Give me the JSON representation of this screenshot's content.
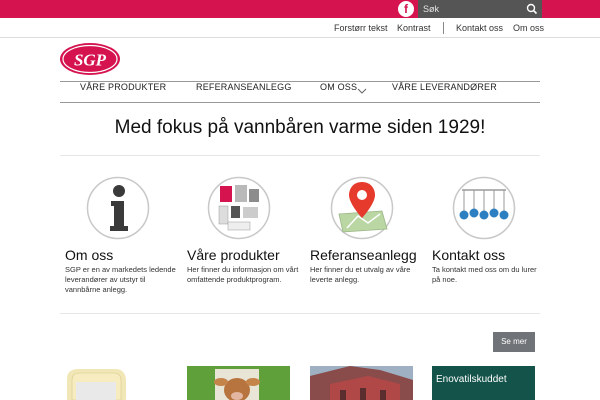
{
  "topbar": {
    "facebook_glyph": "f",
    "search": {
      "placeholder": "Søk"
    }
  },
  "utility_nav": {
    "text_size_label": "Forstørr tekst",
    "contrast_label": "Kontrast",
    "contact_label": "Kontakt oss",
    "about_label": "Om oss"
  },
  "logo": {
    "text": "SGP"
  },
  "main_nav": {
    "items": [
      {
        "label": "VÅRE PRODUKTER"
      },
      {
        "label": "REFERANSEANLEGG"
      },
      {
        "label": "OM OSS"
      },
      {
        "label": "VÅRE LEVERANDØRER"
      }
    ]
  },
  "headline": "Med fokus på vannbåren varme siden 1929!",
  "features": [
    {
      "title": "Om oss",
      "description": "SGP er en av markedets ledende leverandører av utstyr til vannbårne anlegg.",
      "icon": "info-icon"
    },
    {
      "title": "Våre produkter",
      "description": "Her finner du informasjon om vårt omfattende produktprogram.",
      "icon": "products-icon"
    },
    {
      "title": "Referanseanlegg",
      "description": "Her finner du et utvalg av våre leverte anlegg.",
      "icon": "map-pin-icon"
    },
    {
      "title": "Kontakt oss",
      "description": "Ta kontakt med oss om du lurer på noe.",
      "icon": "contact-icon"
    }
  ],
  "more_button_label": "Se mer",
  "news": {
    "enova_text": "Enovatilskuddet"
  },
  "colors": {
    "brand_red": "#d5134f",
    "search_bg": "#555555",
    "button_gray": "#707377"
  }
}
